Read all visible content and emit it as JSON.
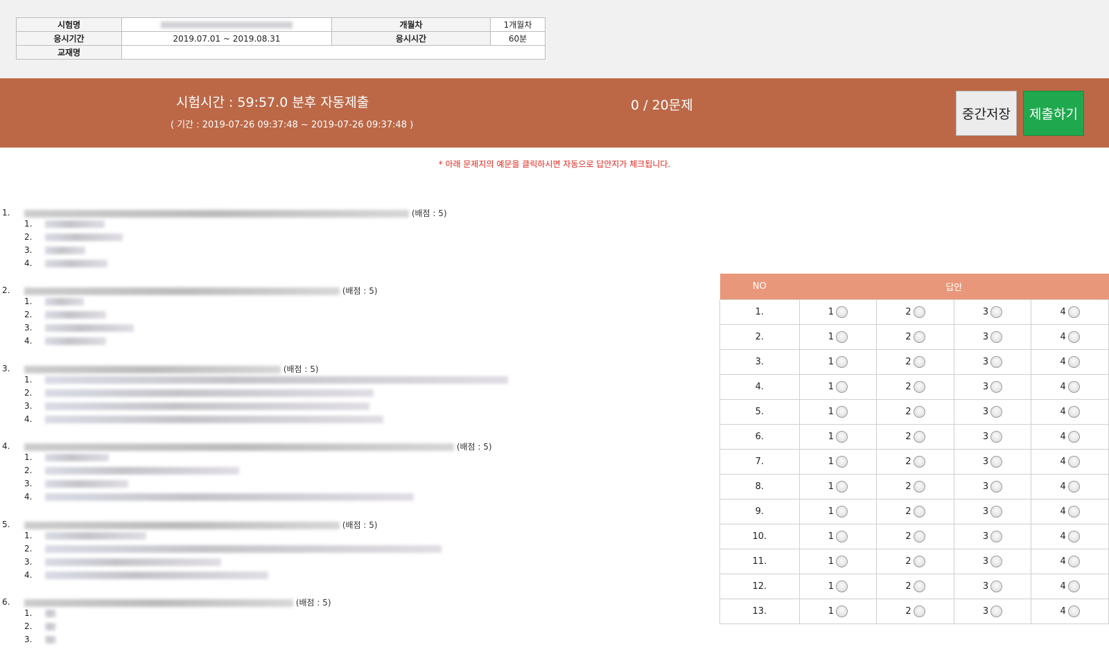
{
  "info": {
    "exam_name_label": "시험명",
    "exam_name_value": "",
    "month_label": "개월차",
    "month_value": "1개월차",
    "period_label": "응시기간",
    "period_value": "2019.07.01 ~ 2019.08.31",
    "duration_label": "응시시간",
    "duration_value": "60분",
    "textbook_label": "교재명",
    "textbook_value": ""
  },
  "bar": {
    "timer": "시험시간 : 59:57.0 분후 자동제출",
    "period": "( 기간 : 2019-07-26 09:37:48 ~ 2019-07-26 09:37:48 )",
    "progress": "0 / 20문제",
    "save_label": "중간저장",
    "submit_label": "제출하기"
  },
  "notice": "* 아래 문제지의 예문을 클릭하시면 자동으로 답안지가 체크됩니다.",
  "questions": [
    {
      "num": "1.",
      "score": "(배점 : 5)",
      "choices": [
        "1.",
        "2.",
        "3.",
        "4."
      ]
    },
    {
      "num": "2.",
      "score": "(배점 : 5)",
      "choices": [
        "1.",
        "2.",
        "3.",
        "4."
      ]
    },
    {
      "num": "3.",
      "score": "(배점 : 5)",
      "choices": [
        "1.",
        "2.",
        "3.",
        "4."
      ]
    },
    {
      "num": "4.",
      "score": "(배점 : 5)",
      "choices": [
        "1.",
        "2.",
        "3.",
        "4."
      ]
    },
    {
      "num": "5.",
      "score": "(배점 : 5)",
      "choices": [
        "1.",
        "2.",
        "3.",
        "4."
      ]
    },
    {
      "num": "6.",
      "score": "(배점 : 5)",
      "choices": [
        "1.",
        "2.",
        "3."
      ]
    }
  ],
  "answer_sheet": {
    "col_no": "NO",
    "col_answer": "답안",
    "option_labels": [
      "1",
      "2",
      "3",
      "4"
    ],
    "rows": [
      "1.",
      "2.",
      "3.",
      "4.",
      "5.",
      "6.",
      "7.",
      "8.",
      "9.",
      "10.",
      "11.",
      "12.",
      "13."
    ]
  }
}
